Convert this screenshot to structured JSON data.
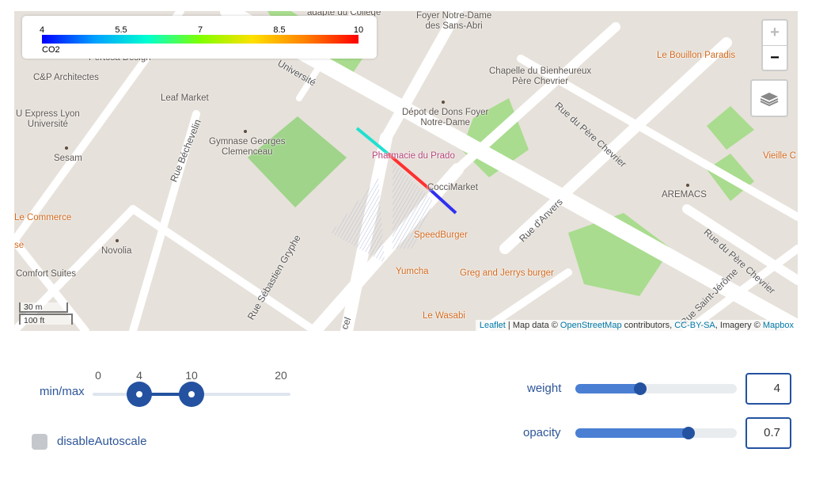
{
  "legend": {
    "ticks": [
      "4",
      "5.5",
      "7",
      "8.5",
      "10"
    ],
    "name": "CO2"
  },
  "zoom": {
    "in": "+",
    "out": "−"
  },
  "scale": {
    "metric": "30 m",
    "imperial": "100 ft"
  },
  "attribution": {
    "leaflet": "Leaflet",
    "mid1": " | Map data © ",
    "osm": "OpenStreetMap",
    "mid2": " contributors, ",
    "license": "CC-BY-SA",
    "mid3": ", Imagery © ",
    "mapbox": "Mapbox"
  },
  "map_labels": {
    "adapte": "adapte du Collège",
    "foyer": "Foyer Notre-Dame\ndes Sans-Abri",
    "bouillon": "Le Bouillon Paradis",
    "pertosa": "Pertosa Design",
    "cp": "C&P Architectes",
    "leafmarket": "Leaf Market",
    "uexpress": "U Express Lyon\nUniversité",
    "sesam": "Sesam",
    "gymnase": "Gymnase Georges\nClemenceau",
    "universite": "Université",
    "chapelle": "Chapelle du Bienheureux\nPère Chevrier",
    "depot": "Dépot de Dons Foyer\nNotre-Dame",
    "pharmacie": "Pharmacie du Prado",
    "cocci": "CocciMarket",
    "ruepere1": "Rue du Père Chevrier",
    "ruebechevelin": "Rue Béchevelin",
    "commerce": "Le Commerce",
    "se": "se",
    "novolia": "Novolia",
    "comfort": "Comfort Suites",
    "ruegryphe": "Rue Sébastien Gryphe",
    "speedburger": "SpeedBurger",
    "yumcha": "Yumcha",
    "greg": "Greg and Jerrys burger",
    "wasabi": "Le Wasabi",
    "ruedanvers": "Rue d'Anvers",
    "aremacs": "AREMACS",
    "vieille": "Vieille C",
    "ruepere2": "Rue du Père Chevrier",
    "ruestjerome": "Rue Saint-Jérôme",
    "cel": "cel"
  },
  "controls": {
    "minmax": {
      "label": "min/max",
      "ticks": [
        "0",
        "4",
        "10",
        "20"
      ],
      "min": 4,
      "max": 10,
      "range": [
        0,
        20
      ]
    },
    "disableAutoscale": {
      "label": "disableAutoscale",
      "checked": false
    },
    "weight": {
      "label": "weight",
      "value": "4",
      "fraction": 0.4
    },
    "opacity": {
      "label": "opacity",
      "value": "0.7",
      "fraction": 0.7
    }
  },
  "colors": {
    "accent": "#2452a0",
    "label": "#2d5598"
  }
}
